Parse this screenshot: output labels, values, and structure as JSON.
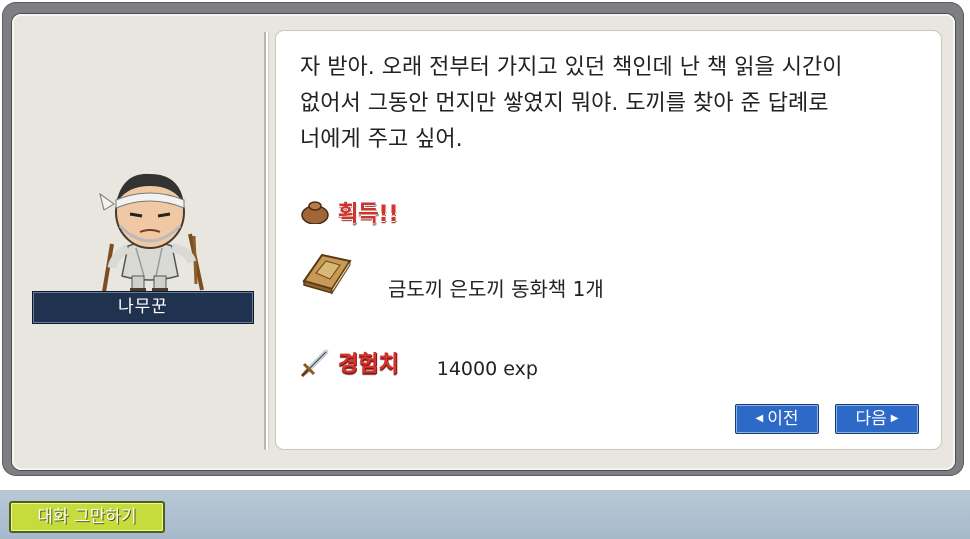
{
  "npc": {
    "name": "나무꾼"
  },
  "dialog": {
    "text": "자 받아. 오래 전부터 가지고 있던 책인데 난 책 읽을 시간이\n없어서 그동안 먼지만 쌓였지 뭐야. 도끼를 찾아 준 답례로\n너에게 주고 싶어.",
    "acquire_label": "획득!!",
    "item": {
      "icon": "book-icon",
      "name": "금도끼 은도끼 동화책 1개"
    },
    "exp": {
      "icon": "sword-icon",
      "label": "경험치",
      "value": "14000 exp"
    },
    "buttons": {
      "prev": "이전",
      "next": "다음"
    }
  },
  "footer": {
    "end_chat": "대화 그만하기"
  },
  "colors": {
    "accent_red": "#d8322c",
    "button_blue": "#2d6ac8",
    "end_button_green": "#c6dc3c",
    "name_plate": "#1f3350"
  }
}
